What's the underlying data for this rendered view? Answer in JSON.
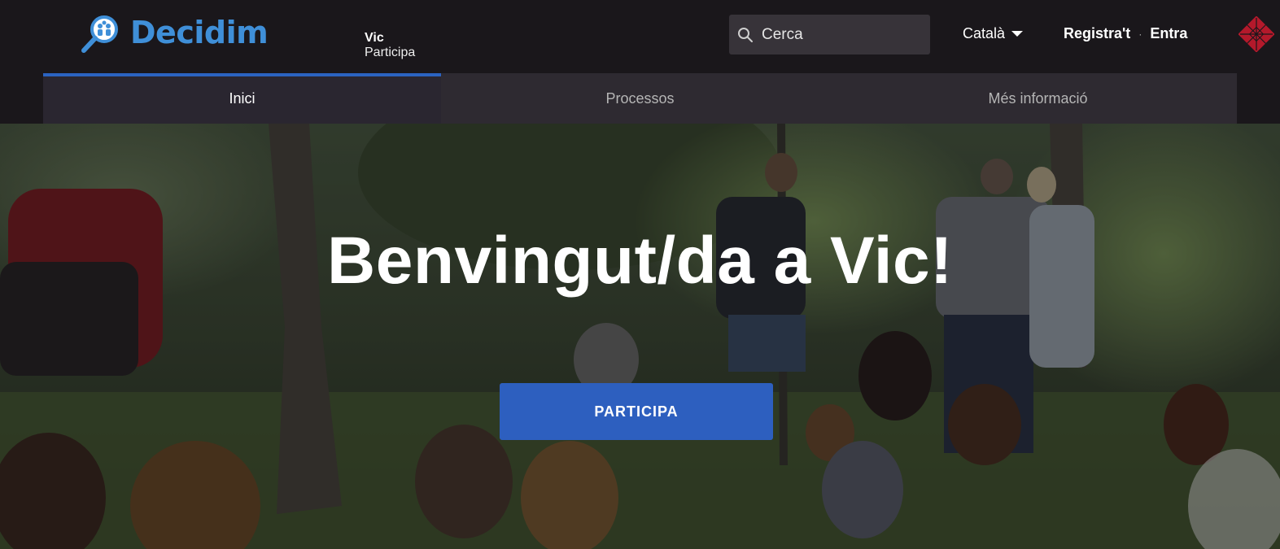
{
  "header": {
    "logo_text_a": "D",
    "logo_text_b": "ecidim",
    "org_line1": "Vic",
    "org_line2": "Participa",
    "search": {
      "placeholder": "Cerca"
    },
    "language": "Català",
    "register": "Registra't",
    "login": "Entra",
    "separator": "·"
  },
  "nav": {
    "items": [
      {
        "label": "Inici",
        "active": true
      },
      {
        "label": "Processos",
        "active": false
      },
      {
        "label": "Més informació",
        "active": false
      }
    ]
  },
  "hero": {
    "title": "Benvingut/da a Vic!",
    "button": "PARTICIPA"
  },
  "colors": {
    "header_bg": "#1a171b",
    "nav_bg": "#2e2a31",
    "accent": "#2d5fbf",
    "logo_blue": "#3f8fd8",
    "logo_red": "#c43a4d"
  }
}
